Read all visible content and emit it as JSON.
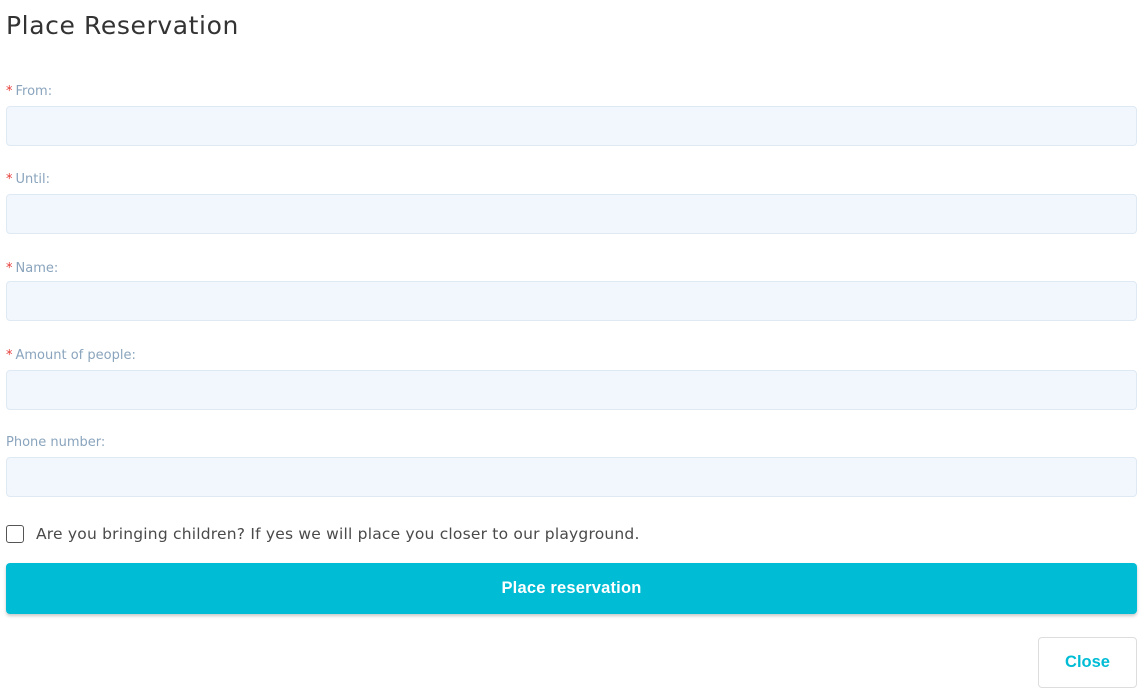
{
  "modal": {
    "title": "Place Reservation"
  },
  "form": {
    "fields": [
      {
        "label": "From:",
        "required": true,
        "value": "",
        "placeholder": ""
      },
      {
        "label": "Until:",
        "required": true,
        "value": "",
        "placeholder": ""
      },
      {
        "label": "Name:",
        "required": true,
        "value": "",
        "placeholder": ""
      },
      {
        "label": "Amount of people:",
        "required": true,
        "value": "",
        "placeholder": ""
      },
      {
        "label": "Phone number:",
        "required": false,
        "value": "",
        "placeholder": ""
      }
    ],
    "required_marker": "*",
    "children_checkbox": {
      "label": "Are you bringing children? If yes we will place you closer to our playground.",
      "checked": false
    },
    "submit_label": "Place reservation"
  },
  "footer": {
    "close_label": "Close"
  },
  "colors": {
    "accent": "#00bcd4",
    "label": "#8aa4bd",
    "required": "#e53935",
    "input_bg": "#f2f7fd",
    "input_border": "#dfe9f3"
  }
}
